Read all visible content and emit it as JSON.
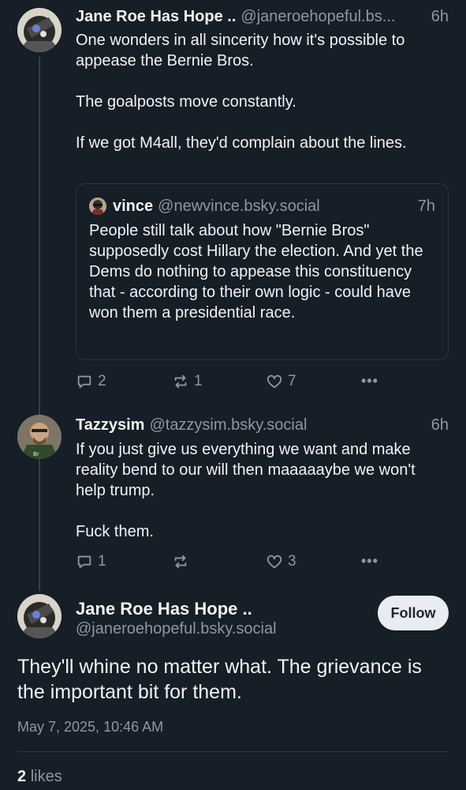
{
  "posts": [
    {
      "author": "Jane Roe Has Hope ..",
      "handle": "@janeroehopeful.bs...",
      "time": "6h",
      "paragraphs": [
        "One wonders in all sincerity how it's possible to appease the Bernie Bros.",
        "The goalposts move constantly.",
        "If we got M4all, they'd complain about the lines."
      ],
      "quote": {
        "author": "vince",
        "handle": "@newvince.bsky.social",
        "time": "7h",
        "text": "People still talk about how \"Bernie Bros\" supposedly cost Hillary the election. And yet the Dems do nothing to appease this constituency that - according to their own logic - could have won them a presidential race."
      },
      "actions": {
        "replies": "2",
        "reposts": "1",
        "likes": "7"
      }
    },
    {
      "author": "Tazzysim",
      "handle": "@tazzysim.bsky.social",
      "time": "6h",
      "paragraphs": [
        "If you just give us everything we want and make reality bend to our will then maaaaaybe we won't help trump.",
        "Fuck them."
      ],
      "actions": {
        "replies": "1",
        "reposts": "",
        "likes": "3"
      }
    }
  ],
  "main_post": {
    "author": "Jane Roe Has Hope ..",
    "handle": "@janeroehopeful.bsky.social",
    "follow_label": "Follow",
    "text": "They'll whine no matter what. The grievance is the important bit for them.",
    "timestamp": "May 7, 2025, 10:46 AM",
    "likes_count": "2",
    "likes_label": "likes"
  },
  "icons": {
    "reply": "reply-icon",
    "repost": "repost-icon",
    "like": "heart-icon",
    "more": "more-options-icon"
  },
  "colors": {
    "background": "#161e27",
    "muted": "#8b98a5",
    "thread_line": "#2e4052"
  }
}
